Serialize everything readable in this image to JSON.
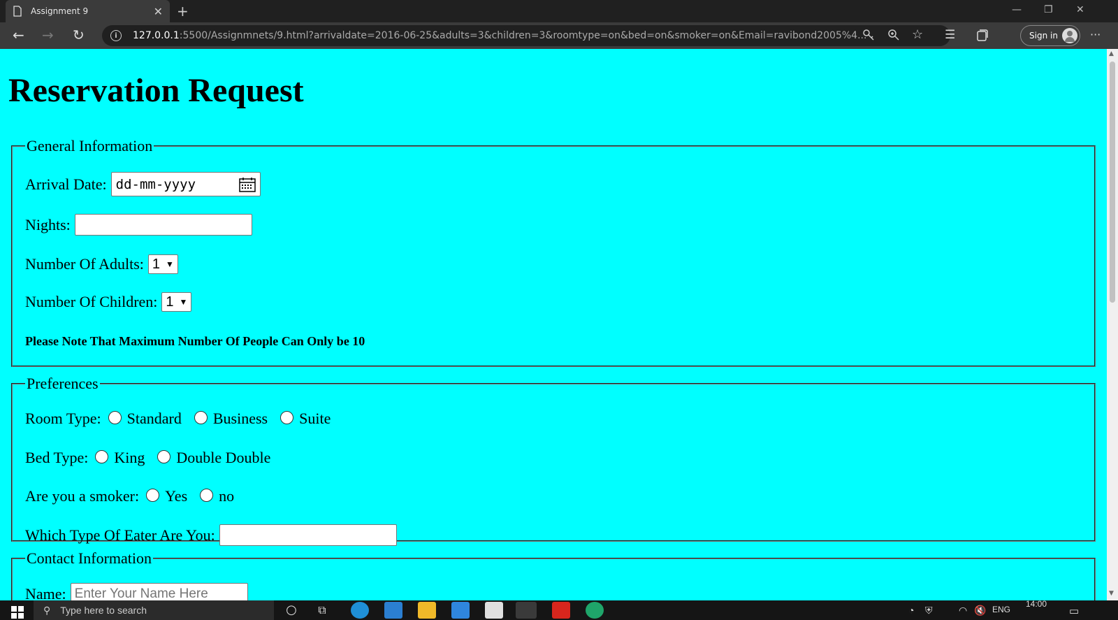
{
  "browser": {
    "tab_title": "Assignment 9",
    "tab_close": "✕",
    "new_tab": "+",
    "url_host": "127.0.0.1",
    "url_rest": ":5500/Assignmnets/9.html?arrivaldate=2016-06-25&adults=3&children=3&roomtype=on&bed=on&smoker=on&Email=ravibond2005%4...",
    "sign_in": "Sign in",
    "window_controls": [
      "—",
      "❐",
      "✕"
    ],
    "more": "···"
  },
  "page": {
    "title": "Reservation Request",
    "general": {
      "legend": "General Information",
      "arrival_label": "Arrival Date:",
      "arrival_value": "dd-mm-yyyy",
      "nights_label": "Nights:",
      "nights_value": "",
      "adults_label": "Number Of Adults:",
      "adults_value": "1",
      "children_label": "Number Of Children:",
      "children_value": "1",
      "note": "Please Note That Maximum Number Of People Can Only be 10"
    },
    "preferences": {
      "legend": "Preferences",
      "room_label": "Room Type:",
      "room_options": [
        "Standard",
        "Business",
        "Suite"
      ],
      "bed_label": "Bed Type:",
      "bed_options": [
        "King",
        "Double Double"
      ],
      "smoker_label": "Are you a smoker:",
      "smoker_options": [
        "Yes",
        "no"
      ],
      "eater_label": "Which Type Of Eater Are You:",
      "eater_value": ""
    },
    "contact": {
      "legend": "Contact Information",
      "name_label": "Name:",
      "name_placeholder": "Enter Your Name Here"
    }
  },
  "taskbar": {
    "search_placeholder": "Type here to search",
    "language": "ENG",
    "time": "14:00"
  },
  "colors": {
    "page_background": "#00ffff",
    "browser_chrome": "#3b3b3b",
    "taskbar": "#151515"
  }
}
